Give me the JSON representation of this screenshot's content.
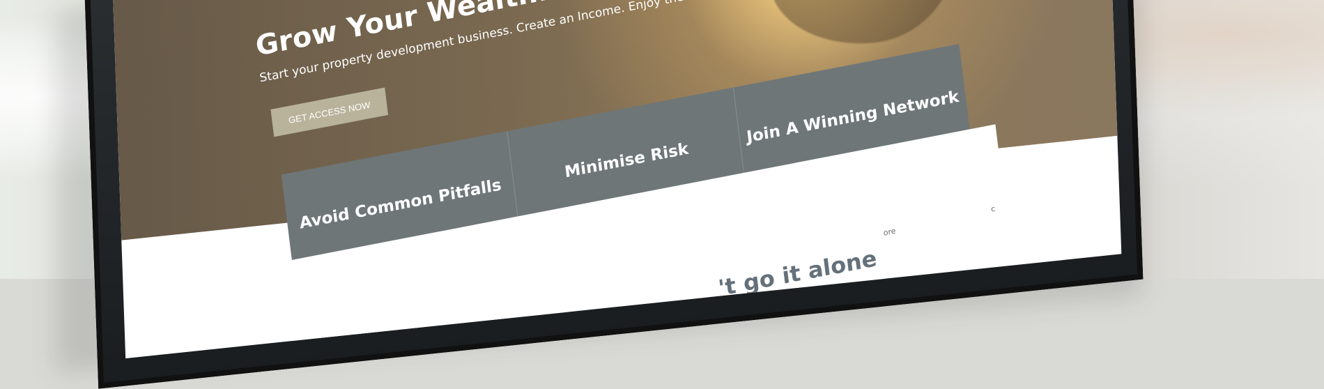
{
  "hero": {
    "headline": "Grow Your Wealth. Build a Legac",
    "subtext": "Start your property development business. Create an Income. Enjoy the freedom and lifestyle y",
    "cta_label": "GET ACCESS NOW"
  },
  "features": [
    {
      "label": "Avoid Common Pitfalls"
    },
    {
      "label": "Minimise Risk"
    },
    {
      "label": "Join A Winning Network"
    }
  ],
  "bottom": {
    "heading": "'t go it alone",
    "fragment_left": "ore",
    "fragment_right": "c"
  }
}
